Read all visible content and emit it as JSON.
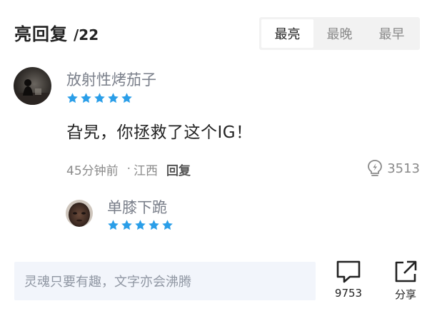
{
  "header": {
    "title": "亮回复",
    "count": "/22"
  },
  "sort_tabs": [
    {
      "label": "最亮",
      "active": true
    },
    {
      "label": "最晚",
      "active": false
    },
    {
      "label": "最早",
      "active": false
    }
  ],
  "comment": {
    "username": "放射性烤茄子",
    "stars": 5,
    "text": "旮旯，你拯救了这个IG！",
    "time": "45分钟前",
    "location": "江西",
    "separator": "·",
    "reply_label": "回复",
    "likes": "3513"
  },
  "reply_preview": {
    "username": "单膝下跪",
    "stars": 5
  },
  "footer": {
    "input_placeholder": "灵魂只要有趣，文字亦会沸腾",
    "comment_count": "9753",
    "share_label": "分享"
  },
  "colors": {
    "star": "#2a9ee8",
    "username": "#7a7f8a",
    "muted": "#8a8a8a",
    "input_bg": "#f2f5fb",
    "tab_bg": "#f2f2f2"
  },
  "icons": {
    "like": "lightbulb-icon",
    "comment": "speech-bubble-icon",
    "share": "share-out-icon",
    "star": "star-icon"
  }
}
